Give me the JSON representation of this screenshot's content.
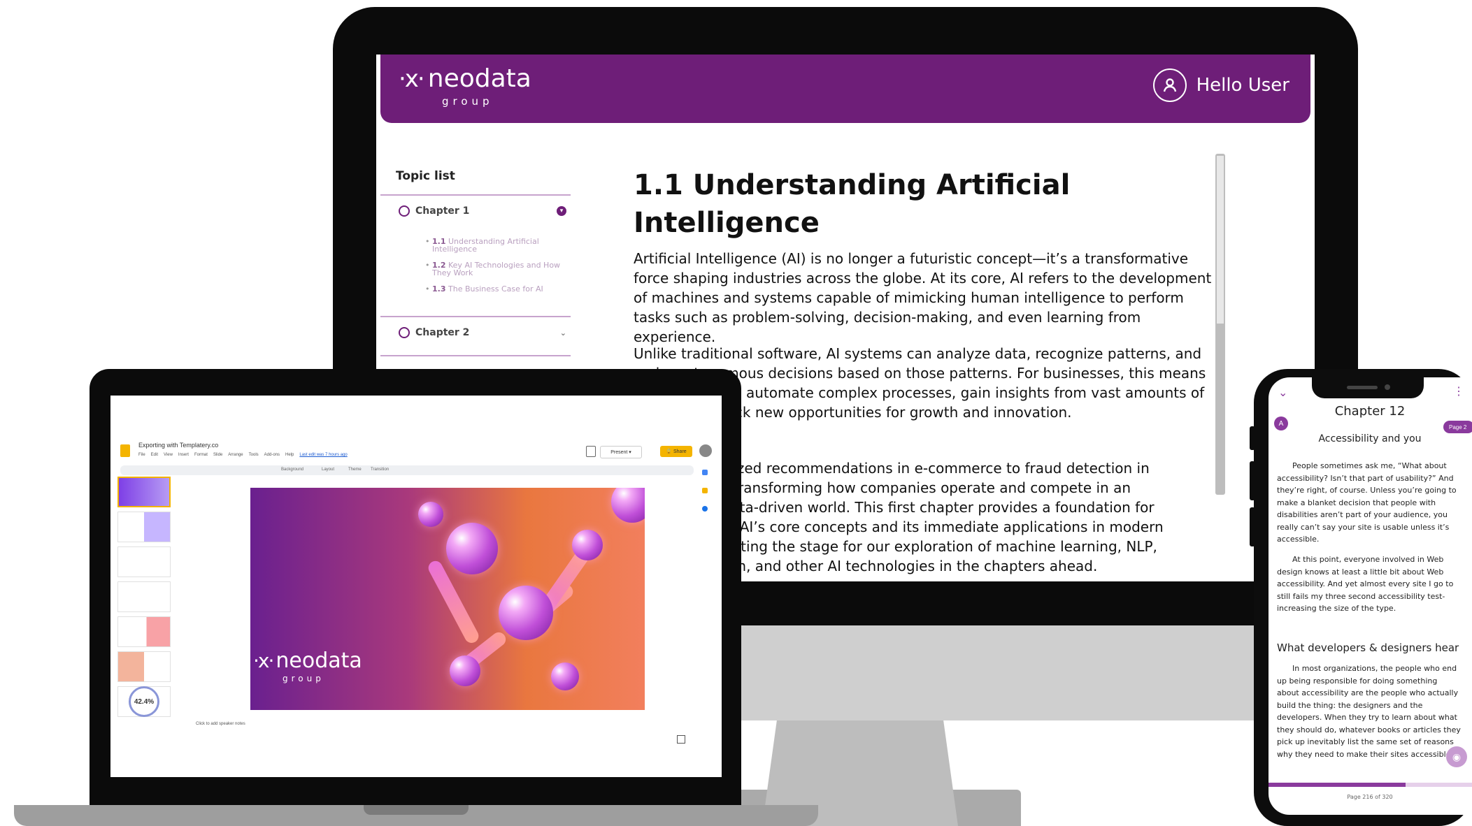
{
  "brand": {
    "logo_mark": "·x·",
    "logo_word": "neodata",
    "logo_sub": "group",
    "accent_color": "#6e1e78"
  },
  "desktop": {
    "header": {
      "user_label": "Hello User",
      "user_icon": "user-circle-icon"
    },
    "sidebar": {
      "title": "Topic list",
      "chapters": [
        {
          "label": "Chapter 1",
          "expanded": true,
          "topics": [
            {
              "num": "1.1",
              "label": "Understanding Artificial Intelligence"
            },
            {
              "num": "1.2",
              "label": "Key AI Technologies and How They Work"
            },
            {
              "num": "1.3",
              "label": "The Business Case for AI"
            }
          ]
        },
        {
          "label": "Chapter 2",
          "expanded": false
        }
      ]
    },
    "content": {
      "title": "1.1 Understanding Artificial Intelligence",
      "paragraphs": [
        "Artificial Intelligence (AI) is no longer a futuristic concept—it’s a transformative force shaping industries across the globe. At its core, AI refers to the development of machines and systems capable of mimicking human intelligence to perform tasks such as problem-solving, decision-making, and even learning from experience.",
        "Unlike traditional software, AI systems can analyze data, recognize patterns, and make autonomous decisions based on those patterns. For businesses, this means the potential to automate complex processes, gain insights from vast amounts of data, and unlock new opportunities for growth and innovation.",
        "From personalized recommendations in e-commerce to fraud detection in banking, AI is transforming how companies operate and compete in an increasingly data-driven world. This first chapter provides a foundation for understanding AI’s core concepts and its immediate applications in modern businesses, setting the stage for our exploration of machine learning, NLP, computer vision, and other AI technologies in the chapters ahead."
      ]
    }
  },
  "laptop": {
    "doc_title": "Exporting with Templatery.co",
    "menu": [
      "File",
      "Edit",
      "View",
      "Insert",
      "Format",
      "Slide",
      "Arrange",
      "Tools",
      "Add-ons",
      "Help"
    ],
    "last_edit": "Last edit was 7 hours ago",
    "present_label": "Present",
    "share_label": "Share",
    "toolbar_items": [
      "Background",
      "Layout",
      "Theme",
      "Transition"
    ],
    "thumb_stat": "42.4%",
    "speaker_notes": "Click to add speaker notes"
  },
  "phone": {
    "chapter": "Chapter 12",
    "avatar_letter": "A",
    "page_badge": "Page 2",
    "subtitle": "Accessibility and you",
    "paragraph1": "People sometimes ask me, “What about accessibility? Isn’t that part of usability?” And they’re right, of course. Unless you’re going to make a blanket decision that people with disabilities aren’t part of your audience, you really can’t say your site is usable unless it’s accessible.",
    "paragraph2": "At this point, everyone involved in Web design knows at least a little bit about Web accessibility. And yet almost every site I go to still fails my three second accessibility test-increasing the size of the type.",
    "heading": "What developers & designers hear",
    "paragraph3": "In most organizations, the people who end up being responsible for doing something about accessibility are the people who actually build the thing: the designers and the developers. When they try to learn about what they should do, whatever books or articles they pick up inevitably list the same set of reasons why they need to make their sites accessible.",
    "footer": "Page 216 of 320",
    "progress": 0.675
  }
}
